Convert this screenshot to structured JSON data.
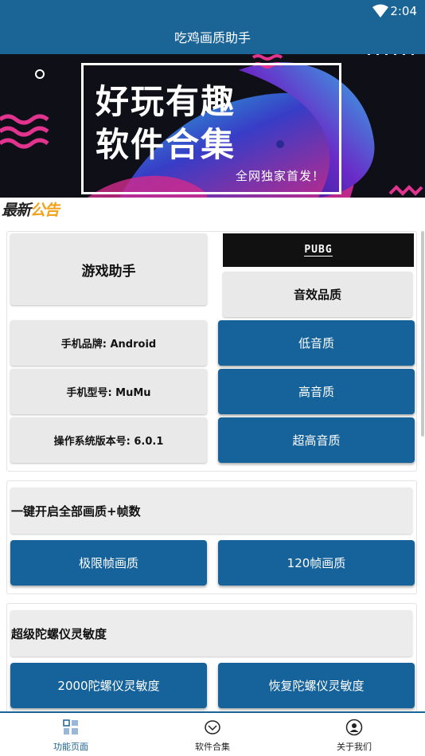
{
  "status_bar": {
    "time": "2:04",
    "icons": [
      "wifi-icon"
    ]
  },
  "app_bar": {
    "title": "吃鸡画质助手"
  },
  "banner": {
    "line1": "好玩有趣",
    "line2": "软件合集",
    "tagline": "全网独家首发！"
  },
  "notice": {
    "part1": "最新",
    "part2": "公告",
    "accent_color": "#f3a21b"
  },
  "card1": {
    "title": "游戏助手",
    "logo_text": "PUBG",
    "audio_label": "音效品质",
    "info": [
      "手机品牌: Android",
      "手机型号: MuMu",
      "操作系统版本号: 6.0.1"
    ],
    "audio_buttons": [
      "低音质",
      "高音质",
      "超高音质"
    ]
  },
  "card2": {
    "title": "一键开启全部画质+帧数",
    "buttons": [
      "极限帧画质",
      "120帧画质"
    ]
  },
  "card3": {
    "title": "超级陀螺仪灵敏度",
    "buttons": [
      "2000陀螺仪灵敏度",
      "恢复陀螺仪灵敏度"
    ]
  },
  "bottom_nav": {
    "items": [
      {
        "label": "功能页面",
        "icon": "grid-icon",
        "active": true
      },
      {
        "label": "软件合集",
        "icon": "shield-icon",
        "active": false
      },
      {
        "label": "关于我们",
        "icon": "person-icon",
        "active": false
      }
    ]
  },
  "colors": {
    "primary": "#1b6496",
    "button": "#16629a",
    "tile": "#e9e9e9"
  }
}
